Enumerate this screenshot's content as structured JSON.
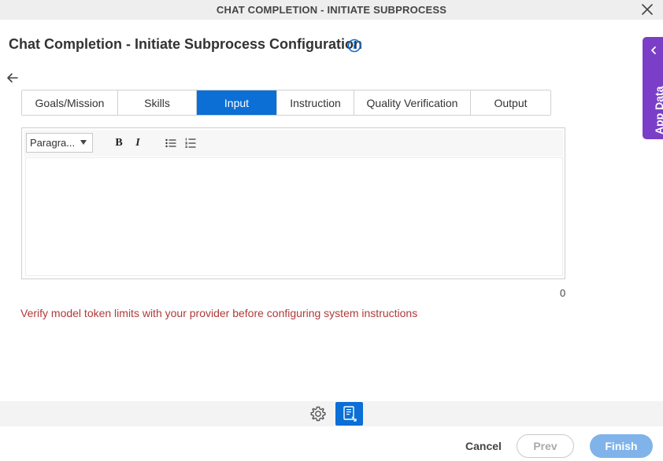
{
  "window": {
    "title": "CHAT COMPLETION - INITIATE SUBPROCESS"
  },
  "page": {
    "title": "Chat Completion - Initiate Subprocess Configuration"
  },
  "side_panel": {
    "label": "App Data"
  },
  "tabs": [
    {
      "label": "Goals/Mission",
      "active": false
    },
    {
      "label": "Skills",
      "active": false
    },
    {
      "label": "Input",
      "active": true
    },
    {
      "label": "Instruction",
      "active": false
    },
    {
      "label": "Quality Verification",
      "active": false
    },
    {
      "label": "Output",
      "active": false
    }
  ],
  "editor": {
    "format_value": "Paragra...",
    "bold_label": "B",
    "italic_label": "I",
    "content": "",
    "char_count": "0"
  },
  "warning": "Verify model token limits with your provider before configuring system instructions",
  "footer": {
    "cancel_label": "Cancel",
    "prev_label": "Prev",
    "finish_label": "Finish"
  },
  "colors": {
    "accent": "#0b6fd6",
    "side_panel": "#7b3fc7",
    "warning": "#b03a3a",
    "finish_disabled": "#7fb3ea"
  },
  "icons": [
    "close-icon",
    "info-icon",
    "back-arrow-icon",
    "chevron-left-icon",
    "dropdown-caret-icon",
    "bulleted-list-icon",
    "numbered-list-icon",
    "gear-icon",
    "document-icon"
  ]
}
